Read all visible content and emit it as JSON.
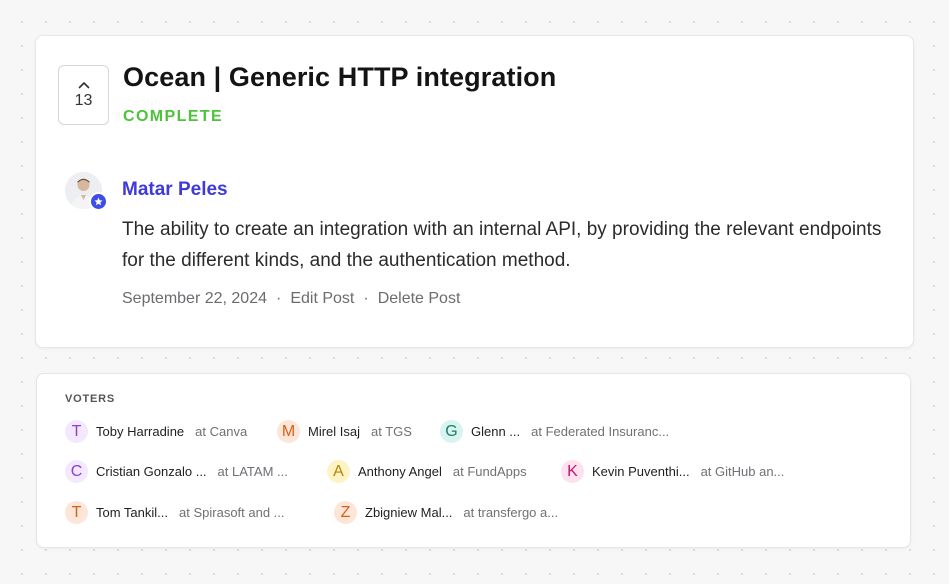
{
  "post": {
    "vote_count": "13",
    "title": "Ocean | Generic HTTP integration",
    "status": "COMPLETE",
    "author": "Matar Peles",
    "body": "The ability to create an integration with an internal API, by providing the relevant endpoints for the different kinds, and the authentication method.",
    "date": "September 22, 2024",
    "separator": "·",
    "edit_label": "Edit Post",
    "delete_label": "Delete Post"
  },
  "voters": {
    "heading": "VOTERS",
    "items": [
      {
        "initial": "T",
        "name": "Toby Harradine",
        "company": "at Canva",
        "bg": "#f3e8fd",
        "fg": "#8b3fd9"
      },
      {
        "initial": "M",
        "name": "Mirel Isaj",
        "company": "at TGS",
        "bg": "#fde6d8",
        "fg": "#d4621c"
      },
      {
        "initial": "G",
        "name": "Glenn ...",
        "company": "at Federated Insuranc...",
        "bg": "#d9f3ee",
        "fg": "#15806b"
      },
      {
        "initial": "C",
        "name": "Cristian Gonzalo ...",
        "company": "at LATAM ...",
        "bg": "#f3e8fd",
        "fg": "#8b3fd9"
      },
      {
        "initial": "A",
        "name": "Anthony Angel",
        "company": "at FundApps",
        "bg": "#fdf3c4",
        "fg": "#b38600"
      },
      {
        "initial": "K",
        "name": "Kevin Puventhi...",
        "company": "at GitHub an...",
        "bg": "#fde1ee",
        "fg": "#c4176b"
      },
      {
        "initial": "T",
        "name": "Tom Tankil...",
        "company": "at Spirasoft and ...",
        "bg": "#fde6d8",
        "fg": "#d4621c"
      },
      {
        "initial": "Z",
        "name": "Zbigniew Mal...",
        "company": "at transfergo a...",
        "bg": "#fde6d8",
        "fg": "#d4621c"
      }
    ]
  },
  "colors": {
    "status": "#4cc43a",
    "author": "#3f3ad8",
    "admin_badge": "#3d4de8"
  },
  "icons": {
    "vote": "chevron-up-icon",
    "badge": "star-icon"
  }
}
